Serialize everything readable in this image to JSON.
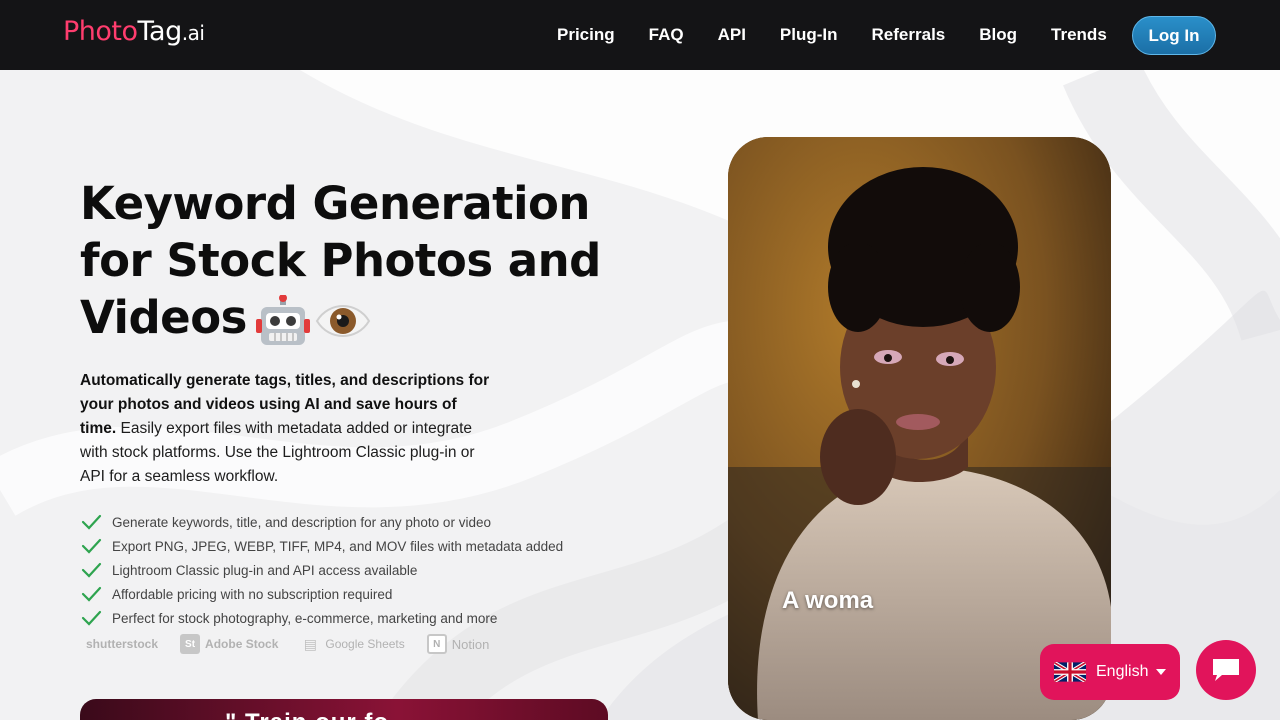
{
  "nav": {
    "logo_photo": "Photo",
    "logo_tag": "Tag",
    "logo_ai": ".ai",
    "links": [
      "Pricing",
      "FAQ",
      "API",
      "Plug-In",
      "Referrals",
      "Blog",
      "Trends"
    ],
    "login_label": "Log In"
  },
  "hero": {
    "headline": "Keyword Generation for Stock Photos and Videos",
    "emoji_icons": [
      "robot-icon",
      "eye-icon"
    ],
    "sub_bold": "Automatically generate tags, titles, and descriptions for your photos and videos using AI and save hours of time.",
    "sub_rest": " Easily export files with metadata added or integrate with stock platforms. Use the Lightroom Classic plug-in or API for a seamless workflow."
  },
  "features": [
    "Generate keywords, title, and description for any photo or video",
    "Export PNG, JPEG, WEBP, TIFF, MP4, and MOV files with metadata added",
    "Lightroom Classic plug-in and API access available",
    "Affordable pricing with no subscription required",
    "Perfect for stock photography, e-commerce, marketing and more"
  ],
  "partners": [
    {
      "label": "shutterstock",
      "icon": ""
    },
    {
      "label": "Adobe Stock",
      "icon": "St"
    },
    {
      "label": "Google Sheets",
      "icon": "▤"
    },
    {
      "label": "Notion",
      "icon": "N"
    }
  ],
  "cta_band_text": "\" Train our fo",
  "photo": {
    "caption": "A woma"
  },
  "language": {
    "selected": "English",
    "flag_icon": "uk-flag-icon"
  },
  "chat": {
    "icon": "chat-bubble-icon"
  },
  "colors": {
    "nav_bg": "#141416",
    "brand_pink": "#ff3d6e",
    "accent_pink": "#e1145b",
    "login_blue": "#1b6fa6",
    "check_green": "#2ea44f"
  }
}
